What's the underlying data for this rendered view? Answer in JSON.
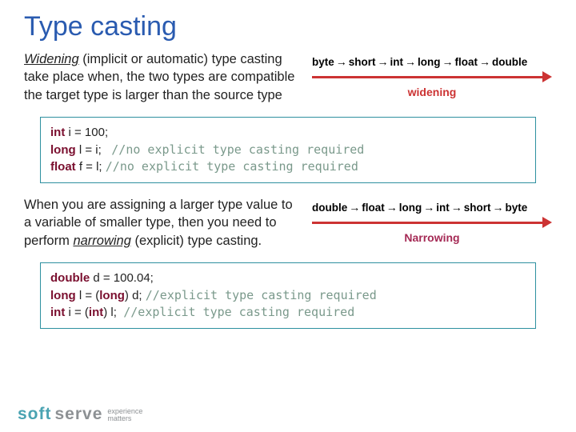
{
  "title": "Type casting",
  "widening": {
    "term": "Widening",
    "para_rest": " (implicit or automatic) type casting take place when, the two types are compatible the target type is larger than the source type",
    "chain": [
      "byte",
      "short",
      "int",
      "long",
      "float",
      "double"
    ],
    "label": "widening"
  },
  "code1": {
    "l1_kw": "int",
    "l1_rest": " i = 100;",
    "l2_kw": "long",
    "l2_rest": " l = i;   ",
    "l2_cm": "//no explicit type casting required",
    "l3_kw": "float",
    "l3_rest": " f = l; ",
    "l3_cm": "//no explicit type casting required"
  },
  "narrowing": {
    "para_pre": "When you are assigning a larger type value to a variable of smaller type, then you need to perform ",
    "term": "narrowing",
    "para_post": " (explicit) type casting.",
    "chain": [
      "double",
      "float",
      "long",
      "int",
      "short",
      "byte"
    ],
    "label": "Narrowing"
  },
  "code2": {
    "l1_kw": "double",
    "l1_rest": " d = 100.04;",
    "l2_kw": "long",
    "l2_mid": " l = (",
    "l2_cast": "long",
    "l2_end": ") d; ",
    "l2_cm": "//explicit type casting required",
    "l3_kw": "int",
    "l3_mid": " i = (",
    "l3_cast": "int",
    "l3_end": ") l;  ",
    "l3_cm": "//explicit type casting required"
  },
  "logo": {
    "a": "soft",
    "b": "serve",
    "tag1": "experience",
    "tag2": "matters"
  }
}
